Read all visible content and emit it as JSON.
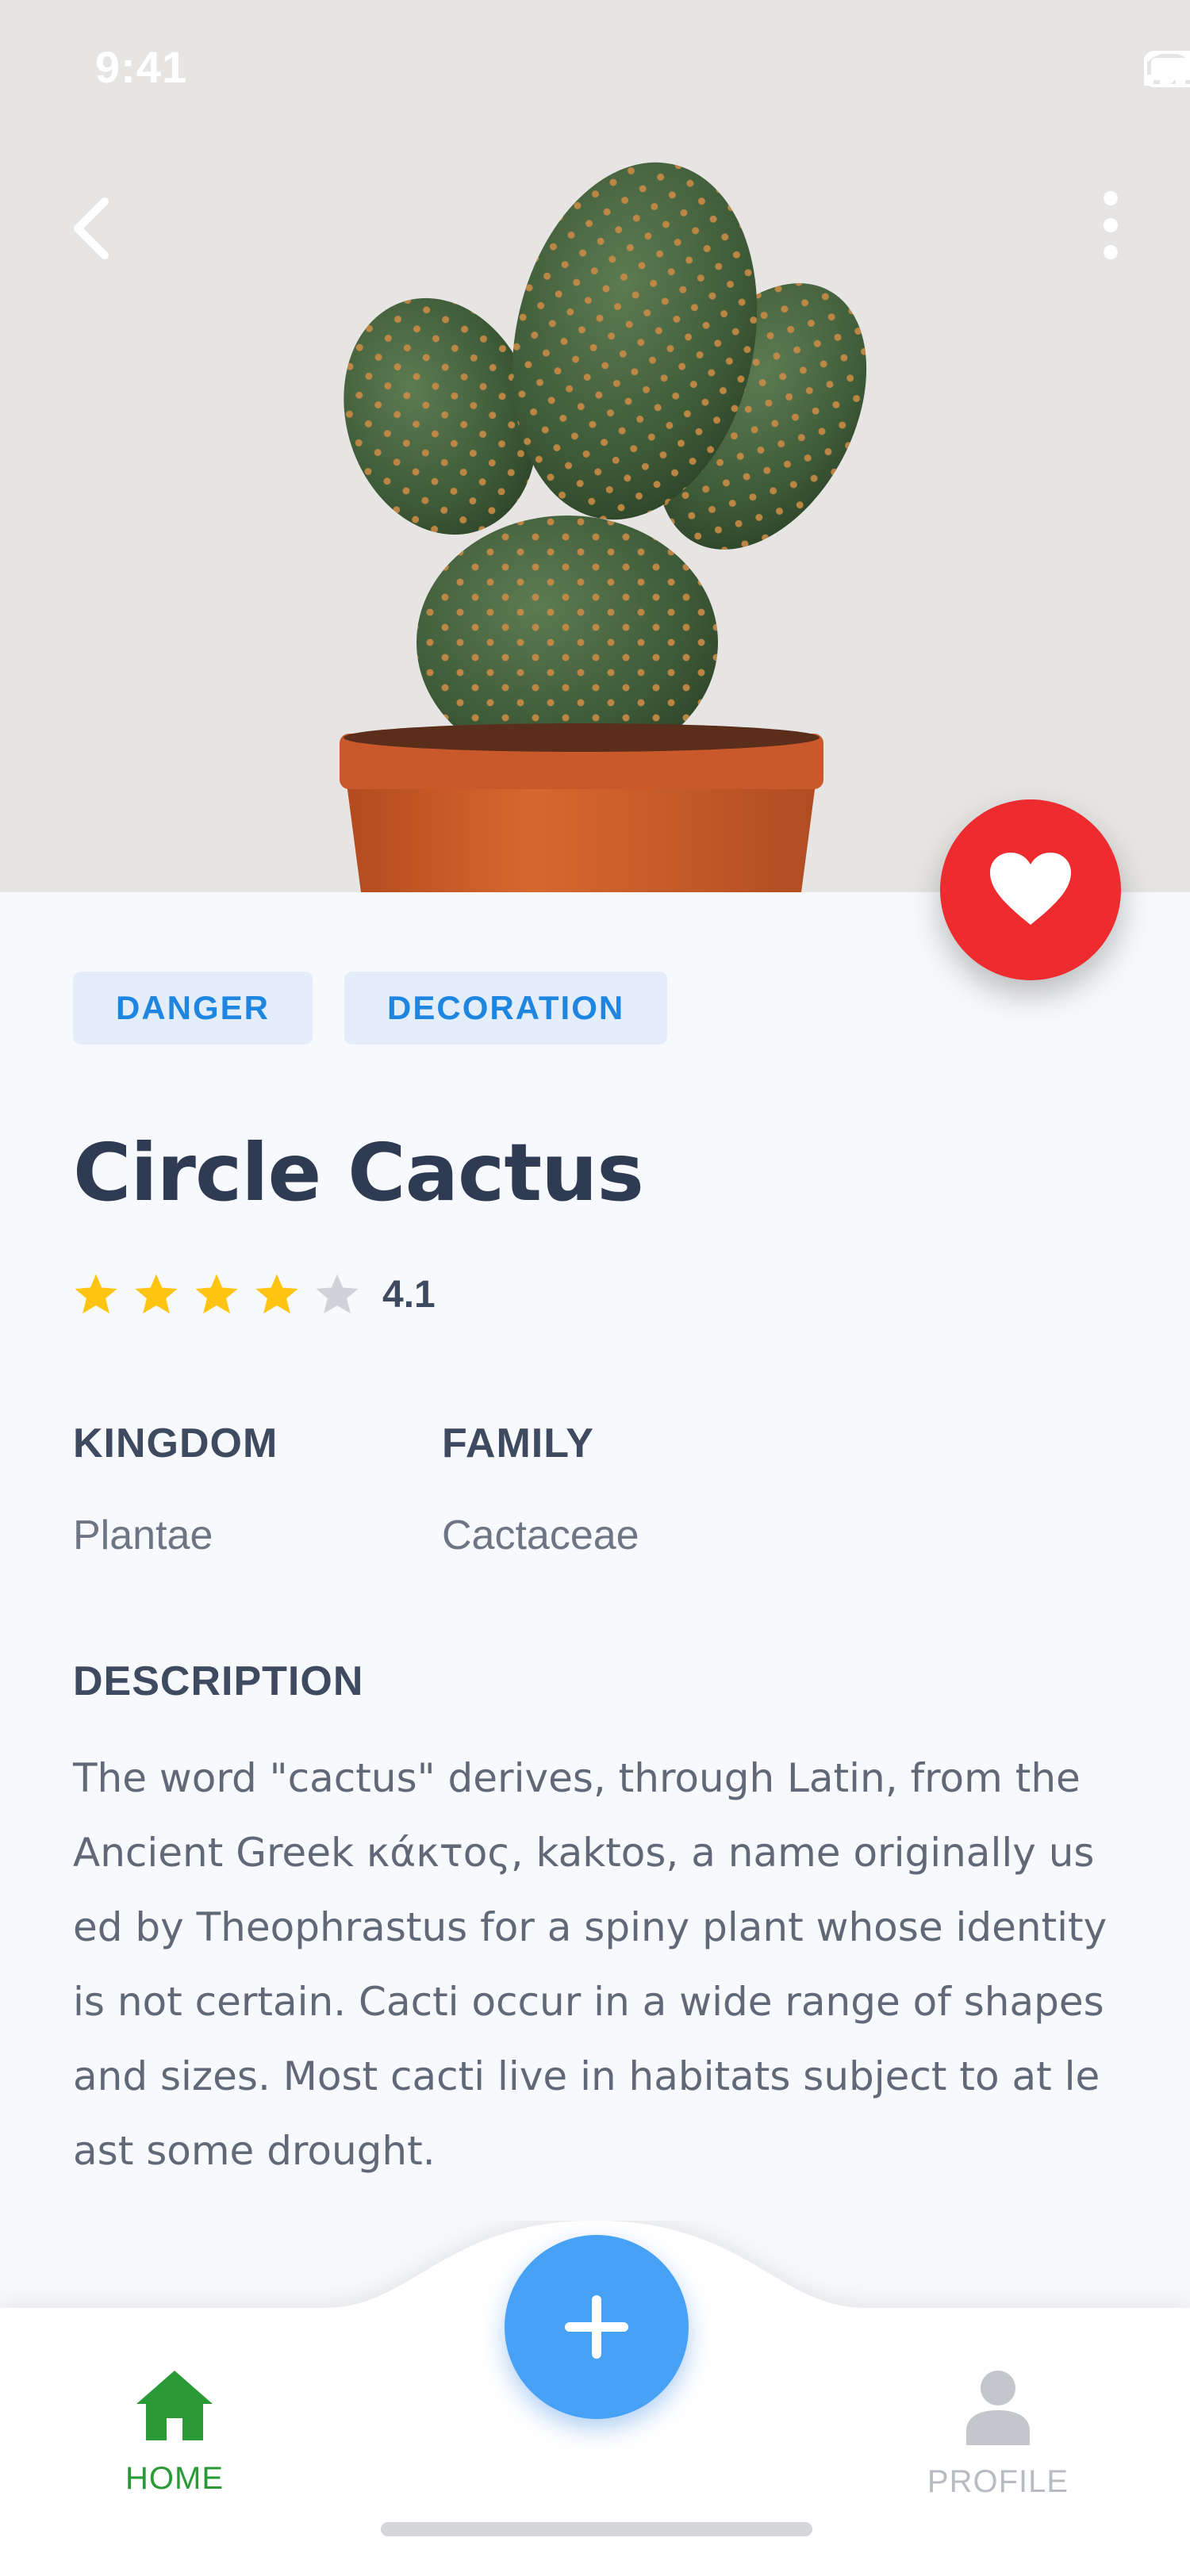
{
  "status_bar": {
    "time": "9:41"
  },
  "plant": {
    "tags": [
      "DANGER",
      "DECORATION"
    ],
    "name": "Circle Cactus",
    "rating": {
      "value": "4.1",
      "stars_total": 5,
      "stars_filled": 4
    },
    "kingdom": {
      "label": "KINGDOM",
      "value": "Plantae"
    },
    "family": {
      "label": "FAMILY",
      "value": "Cactaceae"
    },
    "description": {
      "label": "DESCRIPTION",
      "text": "The word \"cactus\" derives, through Latin, from the Ancient Greek κάκτος, kaktos, a name originally used by Theophrastus for a spiny plant whose identity is not certain. Cacti occur in a wide range of shapes and sizes. Most cacti live in habitats subject to at least some drought."
    }
  },
  "nav": {
    "home_label": "HOME",
    "profile_label": "PROFILE"
  },
  "colors": {
    "accent_red": "#EE2B2F",
    "accent_blue": "#47A1F5",
    "tag_text": "#1E86E0",
    "star_filled": "#FFC412",
    "star_empty": "#CFD2D6",
    "nav_active": "#2A9A37",
    "nav_inactive": "#B8BCC2"
  },
  "icons": {
    "back": "chevron-left-icon",
    "more": "more-vertical-icon",
    "favorite": "heart-icon",
    "add": "plus-icon",
    "home": "home-icon",
    "profile": "user-icon"
  }
}
